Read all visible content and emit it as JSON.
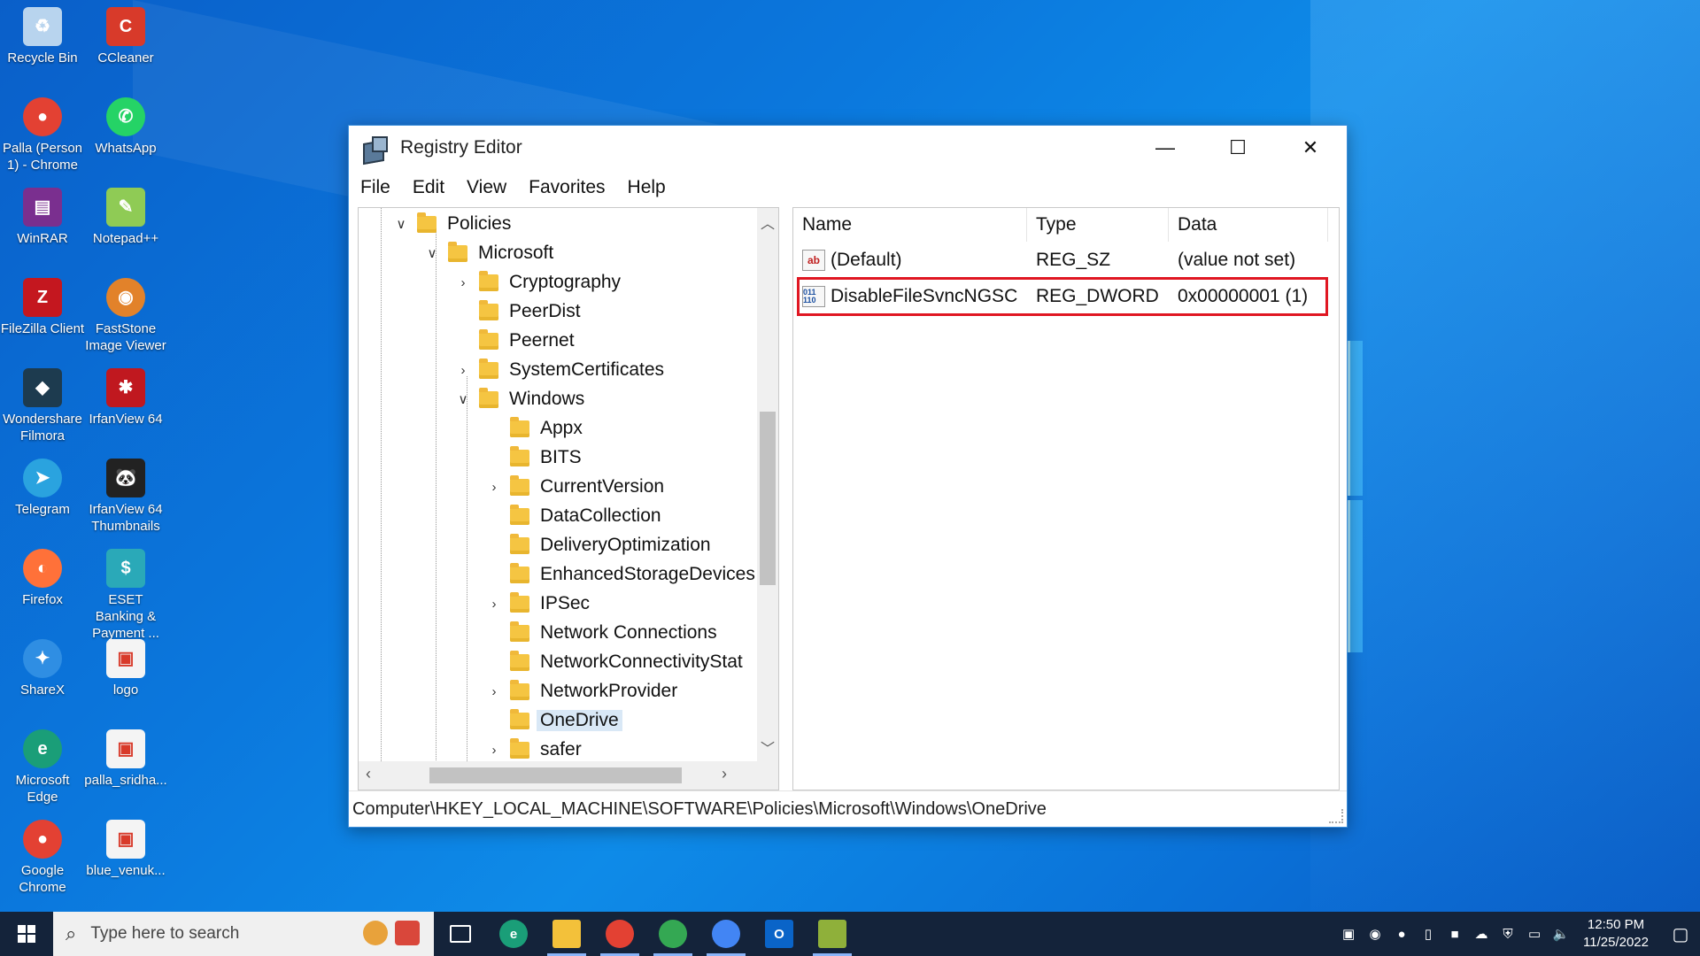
{
  "desktop": {
    "icons": [
      {
        "label": "Recycle Bin"
      },
      {
        "label": "CCleaner"
      },
      {
        "label": "Palla (Person 1) - Chrome"
      },
      {
        "label": "WhatsApp"
      },
      {
        "label": "WinRAR"
      },
      {
        "label": "Notepad++"
      },
      {
        "label": "FileZilla Client"
      },
      {
        "label": "FastStone Image Viewer"
      },
      {
        "label": "Wondershare Filmora"
      },
      {
        "label": "IrfanView 64"
      },
      {
        "label": "Telegram"
      },
      {
        "label": "IrfanView 64 Thumbnails"
      },
      {
        "label": "Firefox"
      },
      {
        "label": "ESET Banking & Payment ..."
      },
      {
        "label": "ShareX"
      },
      {
        "label": "logo"
      },
      {
        "label": "Microsoft Edge"
      },
      {
        "label": "palla_sridha..."
      },
      {
        "label": "Google Chrome"
      },
      {
        "label": "blue_venuk..."
      }
    ]
  },
  "window": {
    "title": "Registry Editor",
    "controls": {
      "minimize": "—",
      "maximize": "☐",
      "close": "✕"
    },
    "menu": [
      "File",
      "Edit",
      "View",
      "Favorites",
      "Help"
    ],
    "tree": [
      {
        "label": "Policies",
        "expander": "∨"
      },
      {
        "label": "Microsoft",
        "expander": "∨"
      },
      {
        "label": "Cryptography",
        "expander": "›"
      },
      {
        "label": "PeerDist",
        "expander": ""
      },
      {
        "label": "Peernet",
        "expander": ""
      },
      {
        "label": "SystemCertificates",
        "expander": "›"
      },
      {
        "label": "Windows",
        "expander": "∨"
      },
      {
        "label": "Appx",
        "expander": ""
      },
      {
        "label": "BITS",
        "expander": ""
      },
      {
        "label": "CurrentVersion",
        "expander": "›"
      },
      {
        "label": "DataCollection",
        "expander": ""
      },
      {
        "label": "DeliveryOptimization",
        "expander": ""
      },
      {
        "label": "EnhancedStorageDevices",
        "expander": ""
      },
      {
        "label": "IPSec",
        "expander": "›"
      },
      {
        "label": "Network Connections",
        "expander": ""
      },
      {
        "label": "NetworkConnectivityStat",
        "expander": ""
      },
      {
        "label": "NetworkProvider",
        "expander": "›"
      },
      {
        "label": "OneDrive",
        "expander": "",
        "selected": true
      },
      {
        "label": "safer",
        "expander": "›"
      }
    ],
    "list": {
      "headers": {
        "name": "Name",
        "type": "Type",
        "data": "Data"
      },
      "rows": [
        {
          "icon": "ab",
          "name": "(Default)",
          "type": "REG_SZ",
          "data": "(value not set)"
        },
        {
          "icon": "011 110",
          "name": "DisableFileSvncNGSC",
          "type": "REG_DWORD",
          "data": "0x00000001 (1)"
        }
      ]
    },
    "status_path": "Computer\\HKEY_LOCAL_MACHINE\\SOFTWARE\\Policies\\Microsoft\\Windows\\OneDrive"
  },
  "taskbar": {
    "search_placeholder": "Type here to search",
    "clock_time": "12:50 PM",
    "clock_date": "11/25/2022"
  },
  "colors": {
    "highlight_border": "#e01722",
    "taskbar": "#14233a",
    "folder": "#f5c542"
  }
}
